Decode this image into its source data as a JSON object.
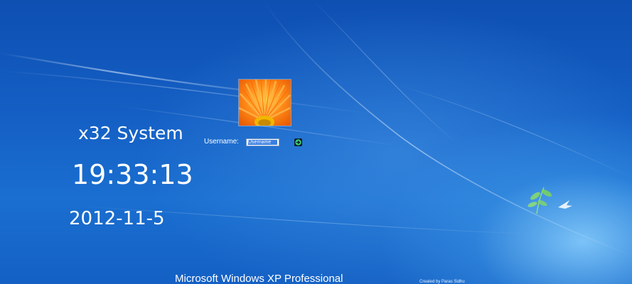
{
  "clock": {
    "system_name": "x32 System",
    "time": "19:33:13",
    "date": "2012-11-5"
  },
  "login": {
    "avatar_icon": "flower-avatar-icon",
    "username_label": "Username:",
    "username_value": "",
    "username_placeholder": "Username",
    "submit_icon": "arrow-right-icon"
  },
  "footer": {
    "os_name": "Microsoft Windows XP Professional",
    "credit": "Created by Paras Sidhu"
  },
  "colors": {
    "background": "#1561c6",
    "accent_glow": "#8cd2ff",
    "text": "#ffffff",
    "avatar_petal": "#ff7a00",
    "submit_button": "#0b1b2c",
    "submit_arrow": "#3bd46b"
  }
}
